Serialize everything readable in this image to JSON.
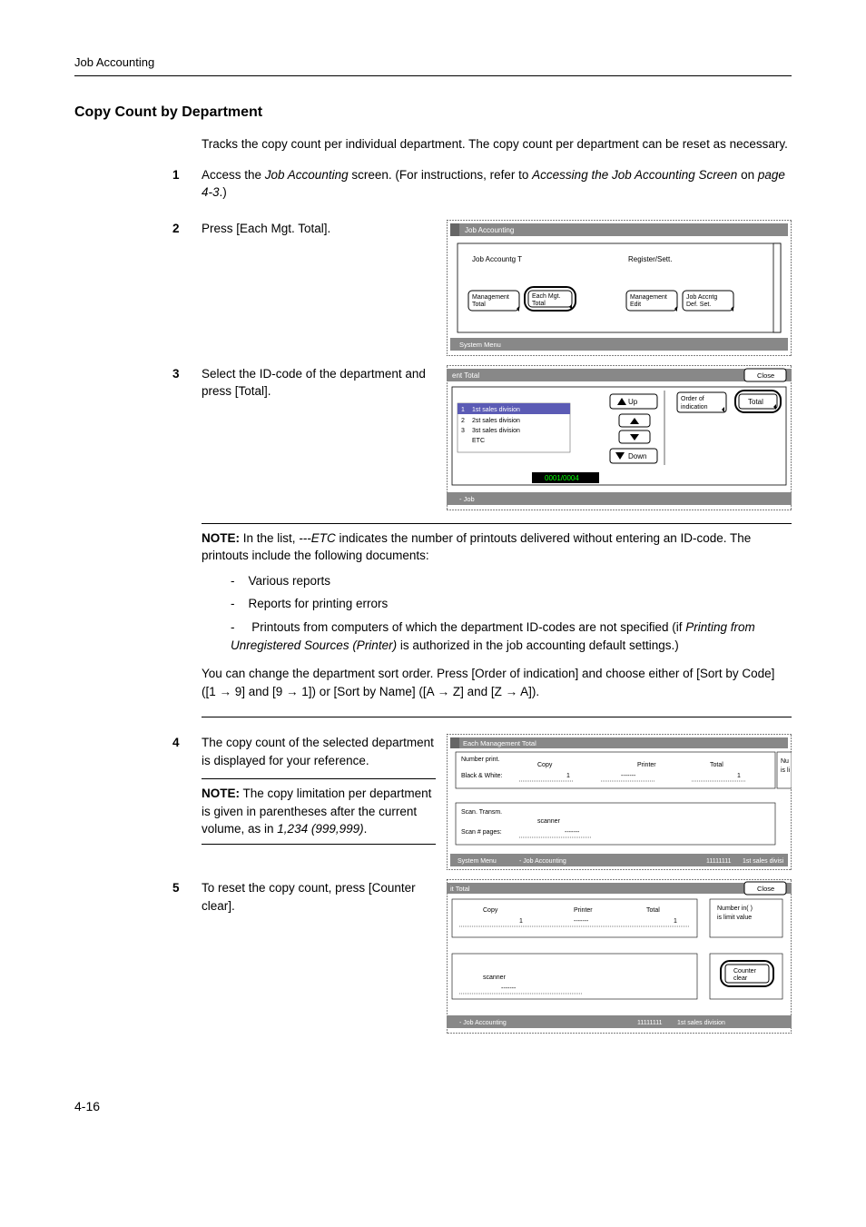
{
  "running_head": "Job Accounting",
  "section_title": "Copy Count by Department",
  "intro": "Tracks the copy count per individual department. The copy count per department can be reset as necessary.",
  "steps": {
    "s1_a": "Access the ",
    "s1_b": "Job Accounting",
    "s1_c": " screen. (For instructions, refer to ",
    "s1_d": "Accessing the Job Accounting Screen",
    "s1_e": " on ",
    "s1_f": "page 4-3",
    "s1_g": ".)",
    "s2": "Press [Each Mgt. Total].",
    "s3": "Select the ID-code of the department and press [Total].",
    "s4": "The copy count of the selected department is displayed for your reference.",
    "s4_note_a": "NOTE:",
    "s4_note_b": " The copy limitation per department is given in parentheses after the current volume, as in ",
    "s4_note_c": "1,234 (999,999)",
    "s4_note_d": ".",
    "s5": "To reset the copy count, press [Counter clear]."
  },
  "note_between": {
    "label": "NOTE:",
    "line1a": " In the list, ",
    "line1b": "---ETC",
    "line1c": " indicates the number of printouts delivered without entering an ID-code. The printouts include the following documents:",
    "b1": "Various reports",
    "b2": "Reports for printing errors",
    "b3a": "Printouts from computers of which the department ID-codes are not specified (if ",
    "b3b": "Printing from Unregistered Sources (Printer)",
    "b3c": " is authorized in the job accounting default settings.)"
  },
  "sort_para": "You can change the department sort order. Press [Order of indication] and choose either of [Sort by Code] ([1 → 9] and [9 → 1]) or [Sort by Name] ([A → Z] and [Z → A]).",
  "page_num": "4-16",
  "fig1": {
    "title": "Job Accounting",
    "left_label": "Job Accountg T",
    "right_label": "Register/Sett.",
    "btn1a": "Management",
    "btn1b": "Total",
    "btn2a": "Each Mgt.",
    "btn2b": "Total",
    "btn3a": "Management",
    "btn3b": "Edit",
    "btn4a": "Job Accntg",
    "btn4b": "Def. Set.",
    "footer": "System Menu"
  },
  "fig2": {
    "title": "ent Total",
    "close": "Close",
    "dep1": "1st sales division",
    "dep2": "2st sales division",
    "dep3": "3st sales division",
    "dep4": "ETC",
    "n1": "1",
    "n2": "2",
    "n3": "3",
    "up": "Up",
    "down": "Down",
    "order1": "Order of",
    "order2": "indication",
    "total": "Total",
    "count": "0001/0004",
    "footer": "-  Job"
  },
  "fig3": {
    "title": "Each Management Total",
    "numprint": "Number print.",
    "bw": "Black & White:",
    "copy": "Copy",
    "printer": "Printer",
    "total": "Total",
    "nu": "Nu",
    "is": "is li",
    "scan_t": "Scan. Transm.",
    "scanner": "scanner",
    "scanpg": "Scan # pages:",
    "v1": "1",
    "footer_l": "System Menu",
    "footer_m": "-  Job Accounting",
    "footer_r1": "11111111",
    "footer_r2": "1st sales divisi"
  },
  "fig4": {
    "title": "it Total",
    "close": "Close",
    "copy": "Copy",
    "printer": "Printer",
    "total": "Total",
    "v1": "1",
    "numin1": "Number in( )",
    "numin2": "is limit value",
    "scanner": "scanner",
    "cc1": "Counter",
    "cc2": "clear",
    "footer_l": "-  Job Accounting",
    "footer_r1": "11111111",
    "footer_r2": "1st sales division"
  }
}
